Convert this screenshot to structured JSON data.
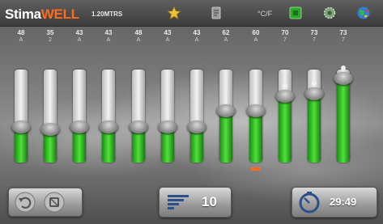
{
  "header": {
    "brand_part1": "Stima",
    "brand_part2": "WELL",
    "model": "1.20MTRS",
    "temperature": "°C/F",
    "icons": [
      "star-icon",
      "document-icon",
      "thermometer-icon",
      "green-square-icon",
      "gear-icon",
      "globe-icon"
    ]
  },
  "colors": {
    "accent_orange": "#ff6a1a",
    "level_green": "#3ccf2a"
  },
  "sliders": [
    {
      "value": "48",
      "index": "A",
      "level": 0.38
    },
    {
      "value": "35",
      "index": "2",
      "level": 0.36
    },
    {
      "value": "43",
      "index": "A",
      "level": 0.38
    },
    {
      "value": "43",
      "index": "A",
      "level": 0.38
    },
    {
      "value": "48",
      "index": "A",
      "level": 0.38
    },
    {
      "value": "43",
      "index": "A",
      "level": 0.38
    },
    {
      "value": "43",
      "index": "A",
      "level": 0.38
    },
    {
      "value": "62",
      "index": "A",
      "level": 0.56
    },
    {
      "value": "60",
      "index": "A",
      "level": 0.56
    },
    {
      "value": "70",
      "index": "7",
      "level": 0.71
    },
    {
      "value": "73",
      "index": "7",
      "level": 0.74
    },
    {
      "value": "73",
      "index": "7",
      "level": 0.9
    }
  ],
  "footer": {
    "intensity_value": "10",
    "timer_value": "29:49"
  }
}
